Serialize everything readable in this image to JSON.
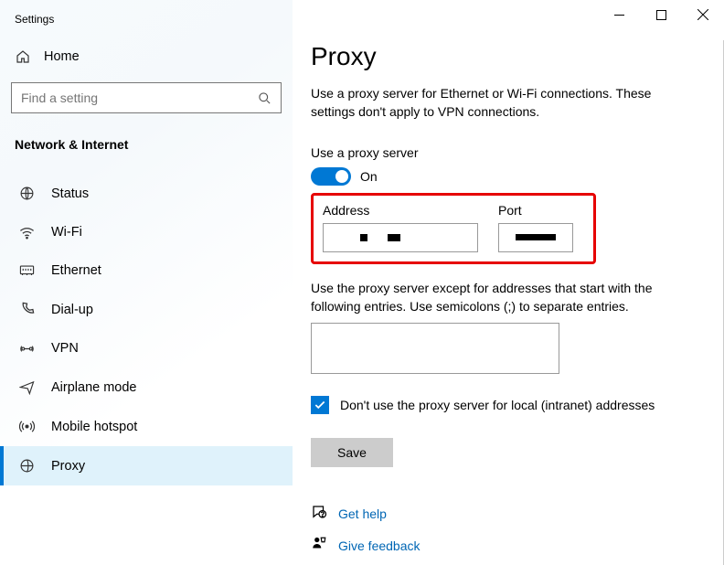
{
  "window": {
    "title": "Settings"
  },
  "sidebar": {
    "home": "Home",
    "search_placeholder": "Find a setting",
    "category": "Network & Internet",
    "items": [
      {
        "label": "Status"
      },
      {
        "label": "Wi-Fi"
      },
      {
        "label": "Ethernet"
      },
      {
        "label": "Dial-up"
      },
      {
        "label": "VPN"
      },
      {
        "label": "Airplane mode"
      },
      {
        "label": "Mobile hotspot"
      },
      {
        "label": "Proxy"
      }
    ]
  },
  "page": {
    "title": "Proxy",
    "description": "Use a proxy server for Ethernet or Wi-Fi connections. These settings don't apply to VPN connections.",
    "use_proxy_label": "Use a proxy server",
    "toggle_state": "On",
    "address_label": "Address",
    "port_label": "Port",
    "exceptions_desc": "Use the proxy server except for addresses that start with the following entries. Use semicolons (;) to separate entries.",
    "bypass_local_label": "Don't use the proxy server for local (intranet) addresses",
    "save_label": "Save",
    "help_label": "Get help",
    "feedback_label": "Give feedback"
  }
}
